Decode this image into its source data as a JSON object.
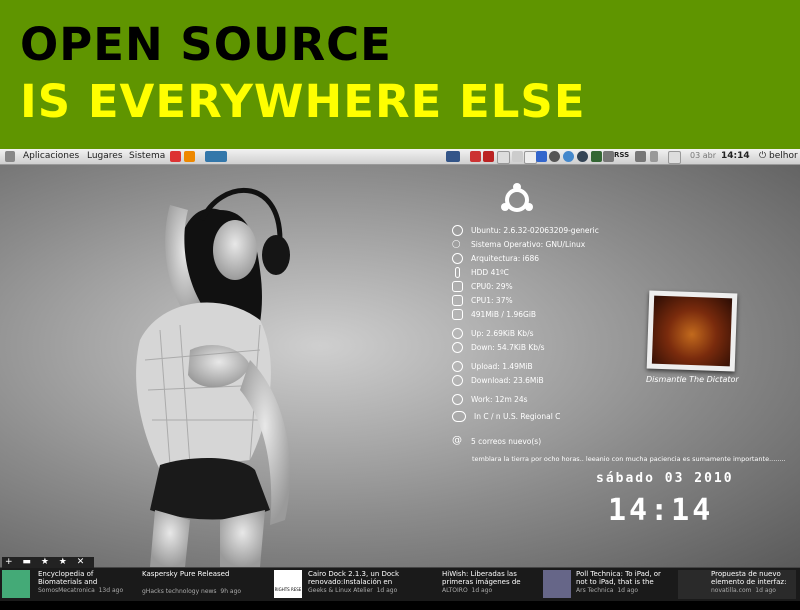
{
  "banner": {
    "line1": "OPEN SOURCE",
    "line2": "IS EVERYWHERE ELSE"
  },
  "panel": {
    "menus": [
      "Aplicaciones",
      "Lugares",
      "Sistema"
    ],
    "date": "03 abr",
    "time": "14:14",
    "user": "belhor",
    "tray_label": "RSS"
  },
  "sysinfo": {
    "kernel": "Ubuntu: 2.6.32-02063209-generic",
    "os": "Sistema Operativo: GNU/Linux",
    "arch": "Arquitectura: i686",
    "hdd": "HDD 41ºC",
    "cpu0": "CPU0: 29%",
    "cpu1": "CPU1: 37%",
    "mem": "491MiB / 1.96GiB",
    "up": "Up: 2.69KiB Kb/s",
    "down": "Down: 54.7KiB Kb/s",
    "upload": "Upload: 1.49MiB",
    "download": "Download: 23.6MiB",
    "work": "Work: 12m 24s",
    "weather": "In C / n U.S. Regional C",
    "mail": "5 correos nuevo(s)",
    "news": "temblara la tierra por ocho horas.. leeanio con mucha paciencia es sumamente importante........",
    "date": "sábado 03 2010",
    "clock": "14:14"
  },
  "album": {
    "caption": "Dismantle The Dictator"
  },
  "toolbar": {
    "add": "+",
    "save": "▬",
    "star": "★",
    "fav": "★",
    "close": "✕"
  },
  "newsbar": [
    {
      "title": "Encyclopedia of Biomaterials and",
      "source": "SomosMecatronica",
      "time": "13d ago"
    },
    {
      "title": "Kaspersky Pure Released",
      "source": "gHacks technology news",
      "time": "9h ago"
    },
    {
      "title": "Cairo Dock 2.1.3, un Dock renovado:Instalación en",
      "source": "Geeks & Linux Atelier",
      "time": "1d ago",
      "badge": "RIGHTS RESE"
    },
    {
      "title": "HiWish: Liberadas las primeras imágenes de",
      "source": "ALTOIRO",
      "time": "1d ago"
    },
    {
      "title": "Poll Technica: To iPad, or not to iPad, that is the",
      "source": "Ars Technica",
      "time": "1d ago"
    },
    {
      "title": "Propuesta de nuevo elemento de interfaz:",
      "source": "novatilla.com",
      "time": "1d ago"
    }
  ],
  "colors": {
    "banner": "#5f9500",
    "banner_line2": "#ffff00"
  }
}
